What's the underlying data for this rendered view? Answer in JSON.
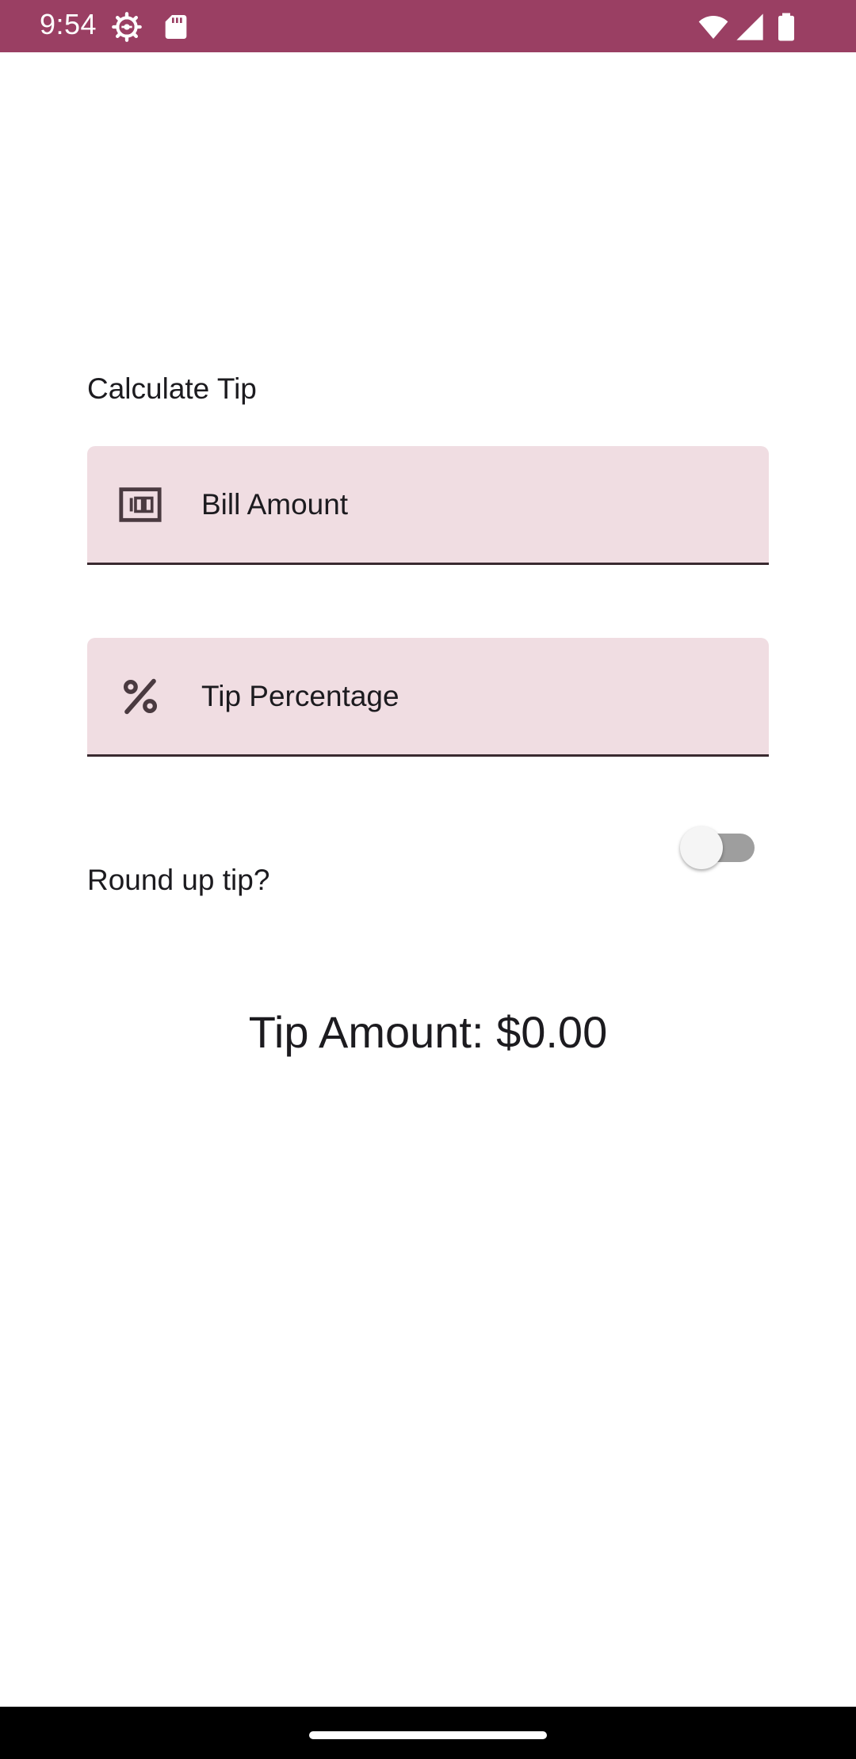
{
  "status_bar": {
    "time": "9:54",
    "icons": [
      "settings-gear-icon",
      "sd-card-icon",
      "wifi-icon",
      "cell-signal-icon",
      "battery-icon"
    ],
    "background": "#9a3f63"
  },
  "screen": {
    "title": "Calculate Tip",
    "bill_field": {
      "placeholder": "Bill Amount",
      "value": "",
      "icon": "money-icon"
    },
    "tip_field": {
      "placeholder": "Tip Percentage",
      "value": "",
      "icon": "percent-icon"
    },
    "round_up": {
      "label": "Round up tip?",
      "checked": false
    },
    "tip_amount": "Tip Amount: $0.00"
  },
  "colors": {
    "field_background": "#f0dde2",
    "field_underline": "#3a2a30",
    "text": "#1c1b1f"
  }
}
